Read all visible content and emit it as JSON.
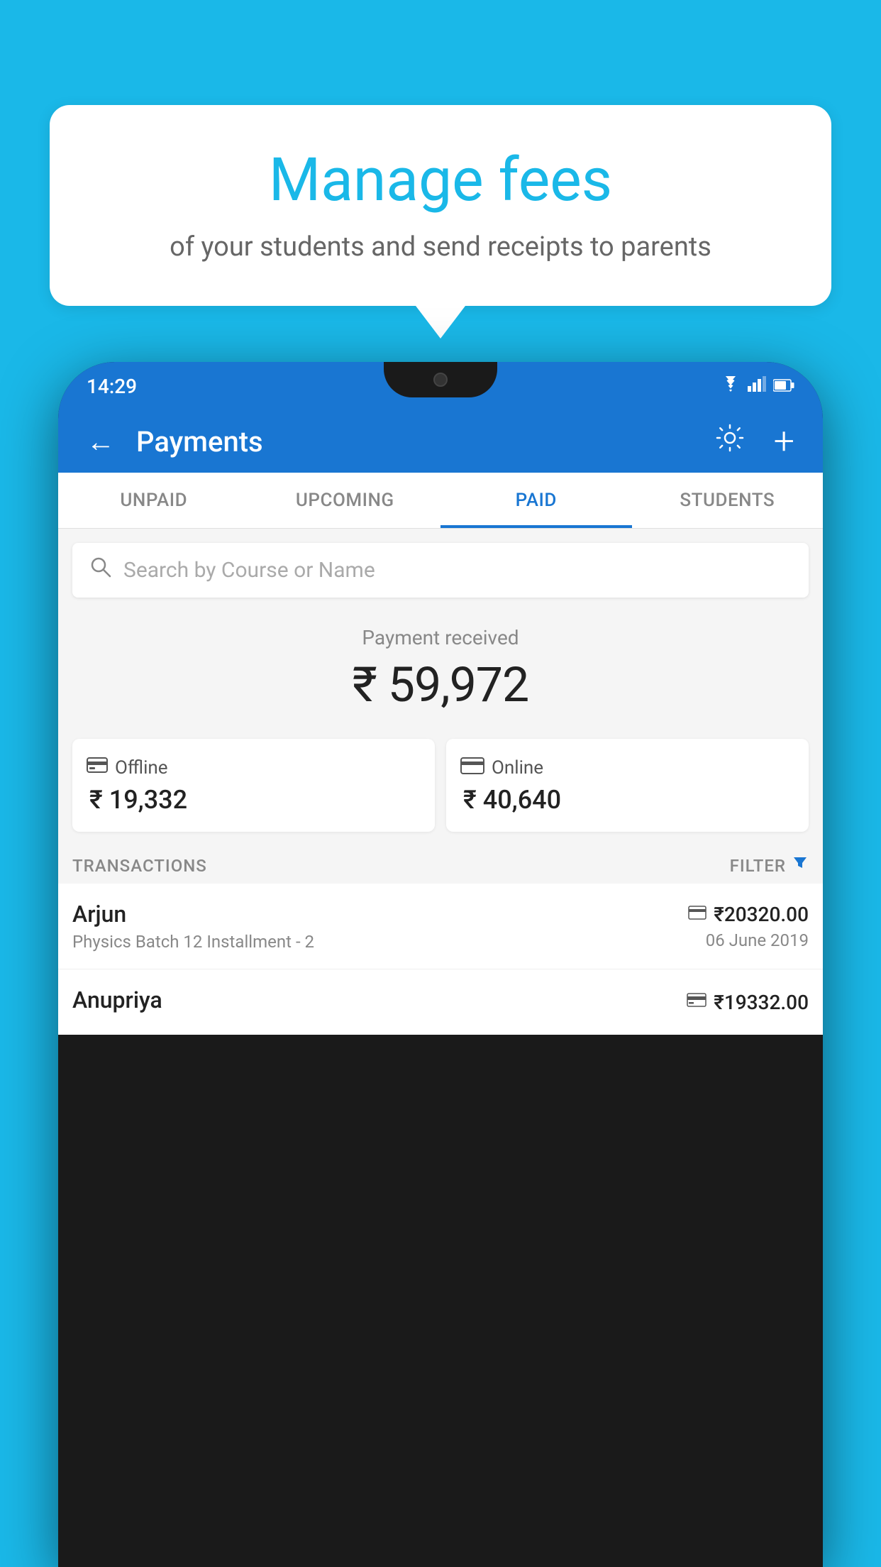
{
  "background_color": "#1ab8e8",
  "speech_bubble": {
    "title": "Manage fees",
    "subtitle": "of your students and send receipts to parents"
  },
  "phone": {
    "status_bar": {
      "time": "14:29",
      "icons": [
        "wifi",
        "signal",
        "battery"
      ]
    },
    "header": {
      "title": "Payments",
      "back_label": "←",
      "gear_label": "⚙",
      "plus_label": "+"
    },
    "tabs": [
      {
        "label": "UNPAID",
        "active": false
      },
      {
        "label": "UPCOMING",
        "active": false
      },
      {
        "label": "PAID",
        "active": true
      },
      {
        "label": "STUDENTS",
        "active": false
      }
    ],
    "search": {
      "placeholder": "Search by Course or Name"
    },
    "payment_summary": {
      "label": "Payment received",
      "amount": "₹ 59,972"
    },
    "payment_methods": [
      {
        "icon": "offline",
        "label": "Offline",
        "amount": "₹ 19,332"
      },
      {
        "icon": "online",
        "label": "Online",
        "amount": "₹ 40,640"
      }
    ],
    "transactions_header": {
      "label": "TRANSACTIONS",
      "filter_label": "FILTER"
    },
    "transactions": [
      {
        "name": "Arjun",
        "description": "Physics Batch 12 Installment - 2",
        "payment_icon": "card",
        "amount": "₹20320.00",
        "date": "06 June 2019"
      },
      {
        "name": "Anupriya",
        "description": "",
        "payment_icon": "offline",
        "amount": "₹19332.00",
        "date": ""
      }
    ]
  }
}
